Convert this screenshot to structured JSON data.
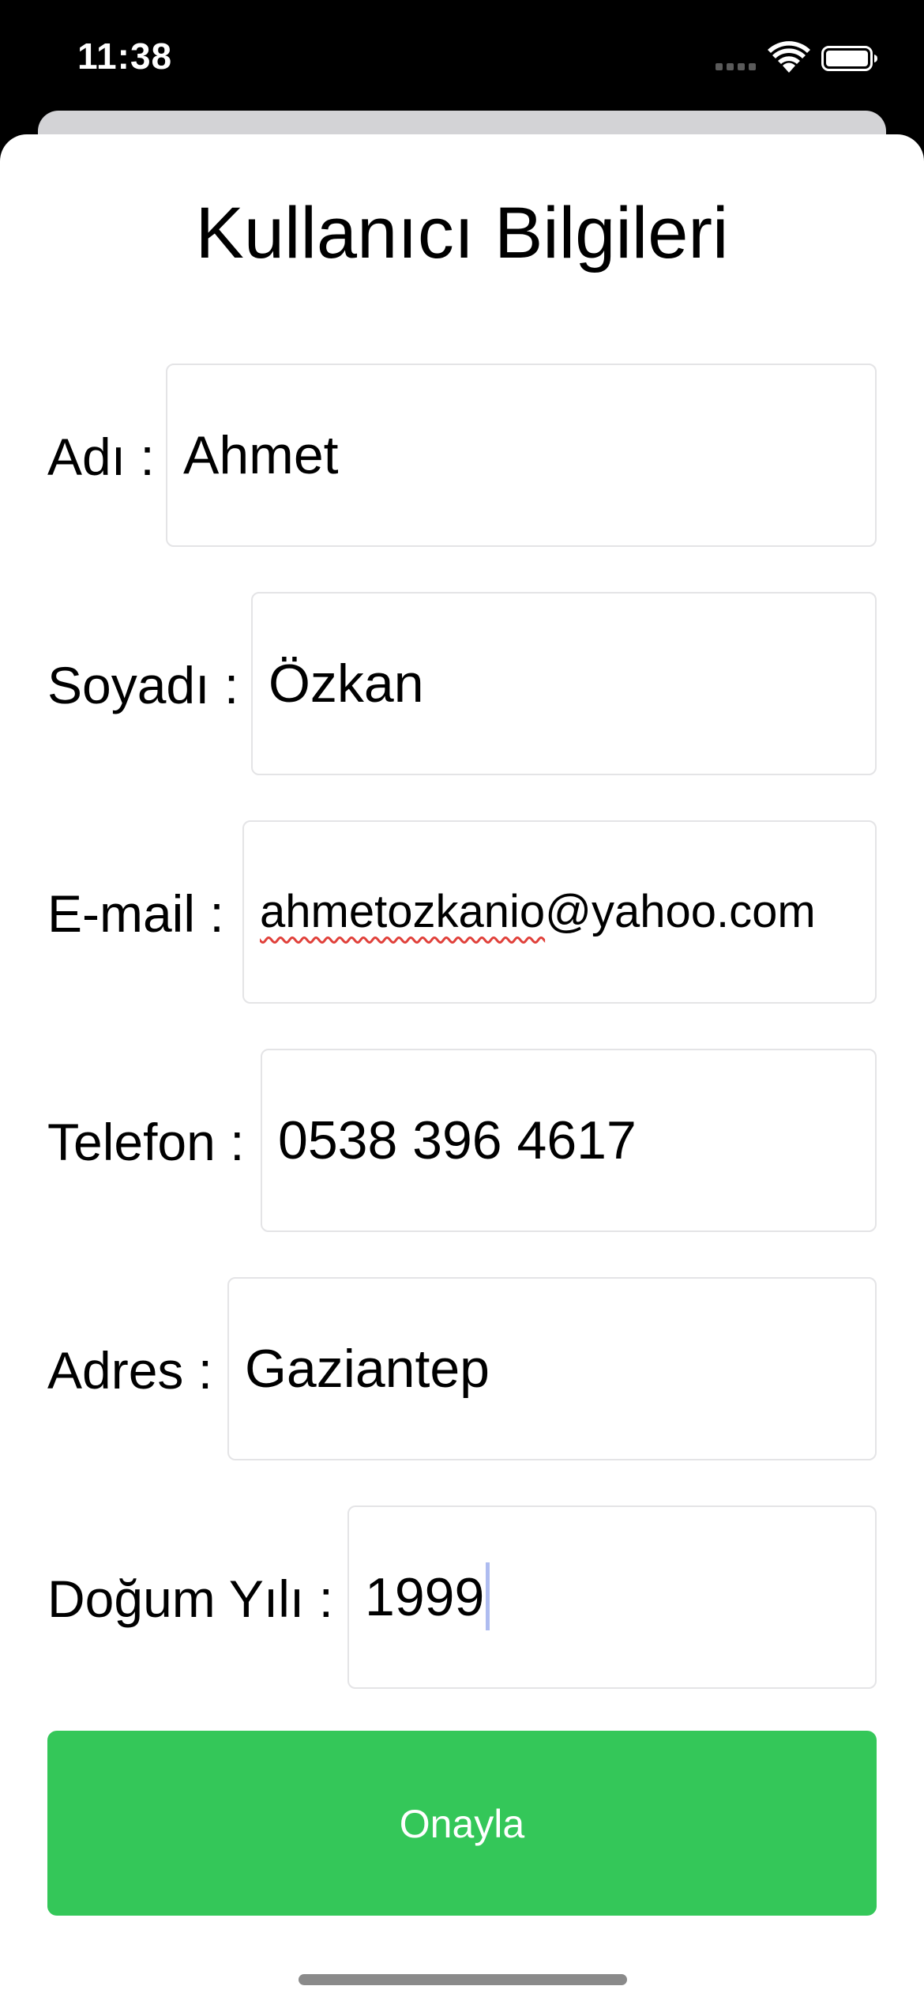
{
  "status_bar": {
    "time": "11:38",
    "icons": [
      "signal-icon",
      "wifi-icon",
      "battery-icon"
    ]
  },
  "form": {
    "title": "Kullanıcı Bilgileri",
    "fields": [
      {
        "label": "Adı :",
        "value": "Ahmet"
      },
      {
        "label": "Soyadı :",
        "value": "Özkan"
      },
      {
        "label": "E-mail :",
        "value": "ahmetozkanio@yahoo.com",
        "value_underlined": "ahmetozkanio",
        "value_rest": "@yahoo.com"
      },
      {
        "label": "Telefon :",
        "value": "0538 396 4617"
      },
      {
        "label": "Adres :",
        "value": "Gaziantep"
      },
      {
        "label": "Doğum Yılı :",
        "value": "1999"
      }
    ],
    "submit_label": "Onayla"
  },
  "colors": {
    "accent_green": "#34c759",
    "spellcheck_red": "#e0403a",
    "caret_blue": "#aebcf0",
    "field_border": "#e4e4e6"
  }
}
